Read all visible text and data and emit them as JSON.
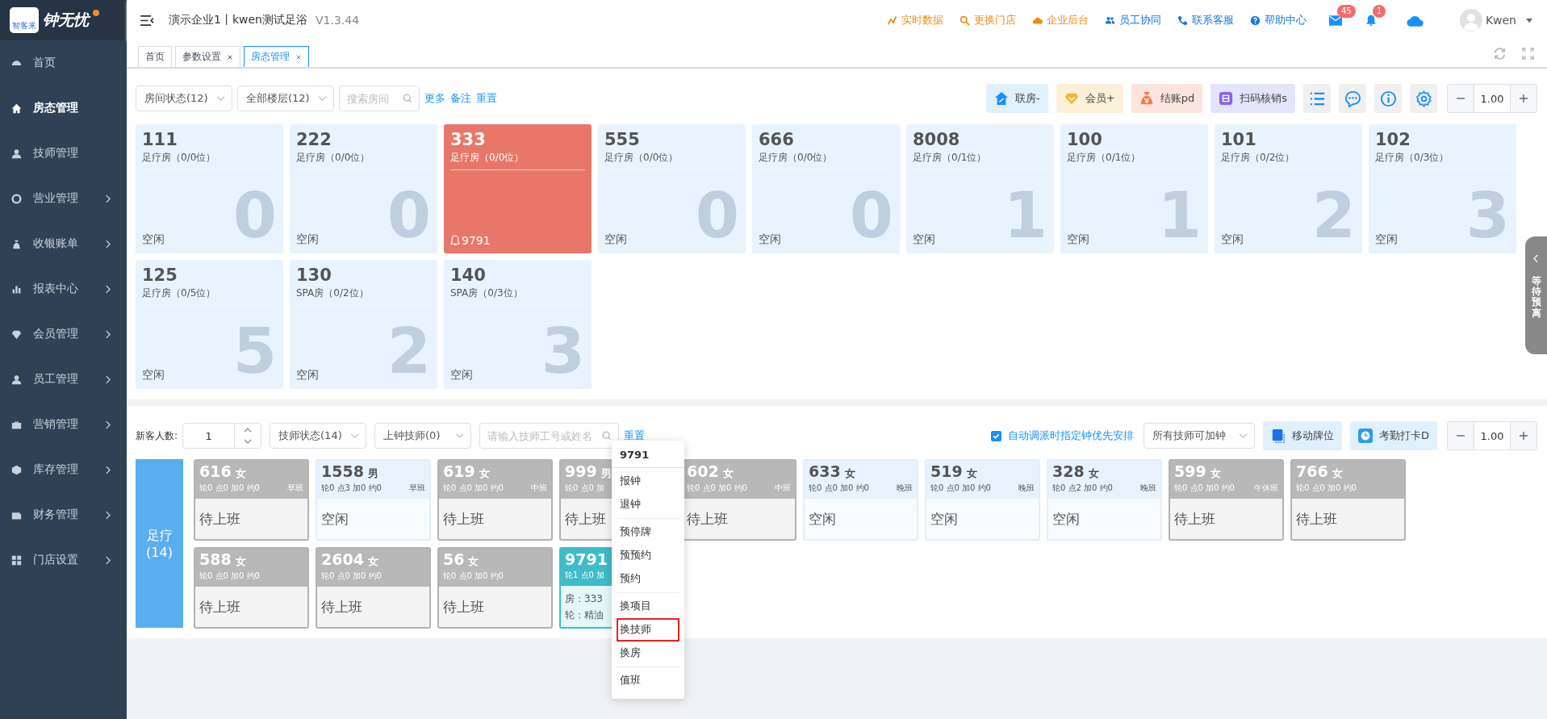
{
  "brand": {
    "logo_caption": "智客来",
    "name": "钟无忧"
  },
  "sidebar": {
    "items": [
      {
        "label": "首页",
        "selected": false,
        "submenu": false
      },
      {
        "label": "房态管理",
        "selected": true,
        "submenu": false
      },
      {
        "label": "技师管理",
        "selected": false,
        "submenu": false
      },
      {
        "label": "营业管理",
        "selected": false,
        "submenu": true
      },
      {
        "label": "收银账单",
        "selected": false,
        "submenu": true
      },
      {
        "label": "报表中心",
        "selected": false,
        "submenu": true
      },
      {
        "label": "会员管理",
        "selected": false,
        "submenu": true
      },
      {
        "label": "员工管理",
        "selected": false,
        "submenu": true
      },
      {
        "label": "营销管理",
        "selected": false,
        "submenu": true
      },
      {
        "label": "库存管理",
        "selected": false,
        "submenu": true
      },
      {
        "label": "财务管理",
        "selected": false,
        "submenu": true
      },
      {
        "label": "门店设置",
        "selected": false,
        "submenu": true
      }
    ]
  },
  "header": {
    "title": "演示企业1丨kwen测试足浴",
    "version": "V1.3.44",
    "links": [
      "实时数据",
      "更换门店",
      "企业后台",
      "员工协同",
      "联系客服",
      "帮助中心"
    ],
    "mail_badge": "45",
    "bell_badge": "1",
    "user": "Kwen"
  },
  "tabs": [
    {
      "label": "首页",
      "selected": false,
      "closable": false
    },
    {
      "label": "参数设置",
      "selected": false,
      "closable": true
    },
    {
      "label": "房态管理",
      "selected": true,
      "closable": true
    }
  ],
  "room_toolbar": {
    "filters": [
      "房间状态(12)",
      "全部楼层(12)"
    ],
    "search": {
      "placeholder": "搜索房间"
    },
    "links": [
      "更多",
      "备注",
      "重置"
    ],
    "actions": [
      "联房-",
      "会员+",
      "结账pd",
      "扫码核销s"
    ],
    "zoom": "1.00"
  },
  "rooms": [
    {
      "number": "111",
      "type": "足疗房（0/0位）",
      "status": "空闲",
      "count": "0",
      "kind": "idle"
    },
    {
      "number": "222",
      "type": "足疗房（0/0位）",
      "status": "空闲",
      "count": "0",
      "kind": "idle"
    },
    {
      "number": "333",
      "type": "足疗房（0/0位）",
      "alert": "9791",
      "kind": "occupied"
    },
    {
      "number": "555",
      "type": "足疗房（0/0位）",
      "status": "空闲",
      "count": "0",
      "kind": "idle"
    },
    {
      "number": "666",
      "type": "足疗房（0/0位）",
      "status": "空闲",
      "count": "0",
      "kind": "idle"
    },
    {
      "number": "8008",
      "type": "足疗房（0/1位）",
      "status": "空闲",
      "count": "1",
      "kind": "idle"
    },
    {
      "number": "100",
      "type": "足疗房（0/1位）",
      "status": "空闲",
      "count": "1",
      "kind": "idle"
    },
    {
      "number": "101",
      "type": "足疗房（0/2位）",
      "status": "空闲",
      "count": "2",
      "kind": "idle"
    },
    {
      "number": "102",
      "type": "足疗房（0/3位）",
      "status": "空闲",
      "count": "3",
      "kind": "idle"
    },
    {
      "number": "125",
      "type": "足疗房（0/5位）",
      "status": "空闲",
      "count": "5",
      "kind": "idle"
    },
    {
      "number": "130",
      "type": "SPA房（0/2位）",
      "status": "空闲",
      "count": "2",
      "kind": "idle"
    },
    {
      "number": "140",
      "type": "SPA房（0/3位）",
      "status": "空闲",
      "count": "3",
      "kind": "idle"
    }
  ],
  "side_drawer": {
    "label": "等待预离"
  },
  "tech_toolbar": {
    "guest_label": "新客人数:",
    "guest_count": "1",
    "filters": [
      "技师状态(14)",
      "上钟技师(0)"
    ],
    "search": {
      "placeholder": "请输入技师工号或姓名"
    },
    "link": "重置",
    "auto_dispatch": {
      "label": "自动调派时指定钟优先安排",
      "checked": true
    },
    "overtime_select": "所有技师可加钟",
    "actions": [
      "移动牌位",
      "考勤打卡D"
    ],
    "zoom": "1.00"
  },
  "category": {
    "label": "足疗",
    "count": "(14)"
  },
  "technicians": [
    {
      "number": "616",
      "gender": "女",
      "stats": "轮0 点0 加0 约0",
      "shift": "早班",
      "status": "待上班",
      "kind": "off"
    },
    {
      "number": "1558",
      "gender": "男",
      "stats": "轮0 点3 加0 约0",
      "shift": "早班",
      "status": "空闲",
      "kind": "idle"
    },
    {
      "number": "619",
      "gender": "女",
      "stats": "轮0 点0 加0 约0",
      "shift": "中班",
      "status": "待上班",
      "kind": "off"
    },
    {
      "number": "999",
      "gender": "男",
      "stats": "轮0 点0 加",
      "status": "待上班",
      "kind": "off"
    },
    {
      "number": "602",
      "gender": "女",
      "stats": "轮0 点0 加0 约0",
      "shift": "中班",
      "status": "待上班",
      "kind": "off"
    },
    {
      "number": "633",
      "gender": "女",
      "stats": "轮0 点0 加0 约0",
      "shift": "晚班",
      "status": "空闲",
      "kind": "idle"
    },
    {
      "number": "519",
      "gender": "女",
      "stats": "轮0 点0 加0 约0",
      "shift": "晚班",
      "status": "空闲",
      "kind": "idle"
    },
    {
      "number": "328",
      "gender": "女",
      "stats": "轮0 点2 加0 约0",
      "shift": "晚班",
      "status": "空闲",
      "kind": "idle"
    },
    {
      "number": "599",
      "gender": "女",
      "stats": "轮0 点0 加0 约0",
      "shift": "午休班",
      "status": "待上班",
      "kind": "off"
    },
    {
      "number": "766",
      "gender": "女",
      "stats": "轮0 点0 加0 约0",
      "status": "待上班",
      "kind": "off"
    },
    {
      "number": "588",
      "gender": "女",
      "stats": "轮0 点0 加0 约0",
      "status": "待上班",
      "kind": "off"
    },
    {
      "number": "2604",
      "gender": "女",
      "stats": "轮0 点0 加0 约0",
      "status": "待上班",
      "kind": "off"
    },
    {
      "number": "56",
      "gender": "女",
      "stats": "轮0 点0 加0 约0",
      "status": "待上班",
      "kind": "off"
    },
    {
      "number": "9791",
      "stats": "轮1 点0 加",
      "details": [
        "房：333",
        "轮：精油"
      ],
      "kind": "busy"
    }
  ],
  "context_menu": {
    "title": "9791",
    "groups": [
      [
        {
          "label": "报钟",
          "highlighted": false
        },
        {
          "label": "退钟",
          "highlighted": false
        }
      ],
      [
        {
          "label": "预停牌",
          "highlighted": false
        },
        {
          "label": "预预约",
          "highlighted": false
        },
        {
          "label": "预约",
          "highlighted": false
        }
      ],
      [
        {
          "label": "换项目",
          "highlighted": false
        },
        {
          "label": "换技师",
          "highlighted": true
        },
        {
          "label": "换房",
          "highlighted": false
        }
      ],
      [
        {
          "label": "值班",
          "highlighted": false
        }
      ]
    ]
  }
}
